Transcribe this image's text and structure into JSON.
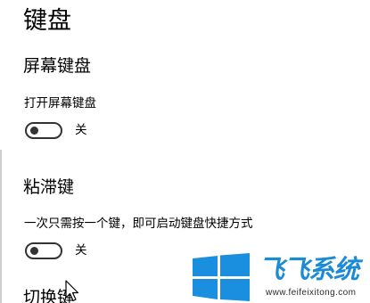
{
  "page": {
    "title": "键盘"
  },
  "sections": [
    {
      "title": "屏幕键盘",
      "setting_label": "打开屏幕键盘",
      "toggle_state": "关",
      "toggle_on": false
    },
    {
      "title": "粘滞键",
      "setting_label": "一次只需按一个键，即可启动键盘快捷方式",
      "toggle_state": "关",
      "toggle_on": false
    }
  ],
  "next_section": {
    "title_partial": "切换键"
  },
  "watermark": {
    "brand": "飞飞系统",
    "url": "www.feifeixitong.com",
    "color": "#1c8bd6"
  },
  "icons": {
    "cursor": "mouse-pointer-icon",
    "logo": "windows-logo-icon"
  }
}
